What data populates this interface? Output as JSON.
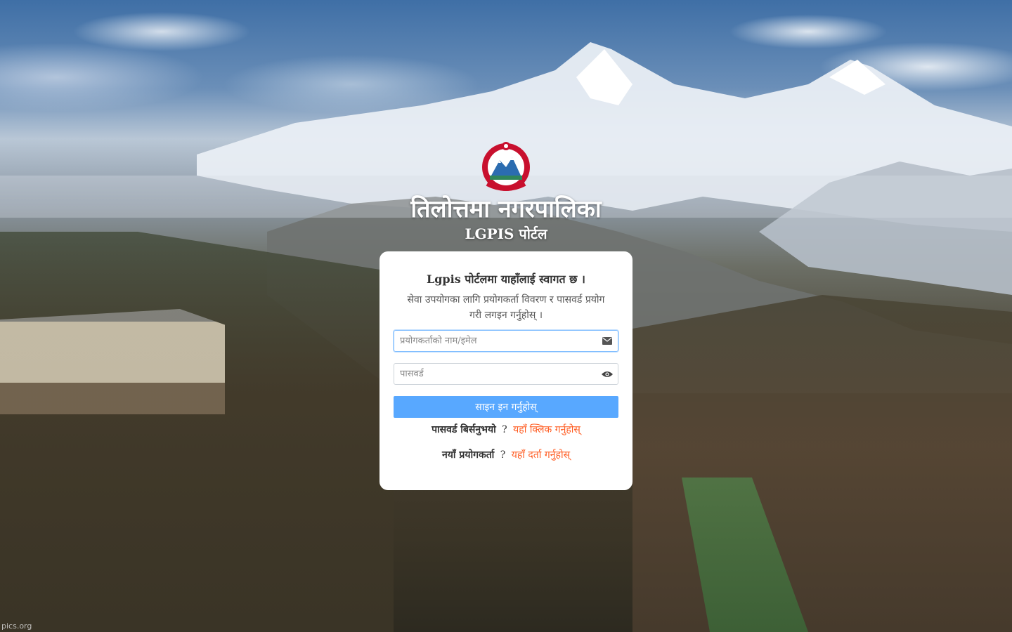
{
  "header": {
    "org_title": "तिलोत्तमा नगरपालिका",
    "portal_title": "LGPIS पोर्टल",
    "emblem_icon": "nepal-emblem-icon"
  },
  "login": {
    "welcome": "Lgpis पोर्टलमा याहाँलाई स्वागत छ ।",
    "description": "सेवा उपयोगका लागि प्रयोगकर्ता विवरण र पासवर्ड प्रयोग गरी लगइन गर्नुहोस् ।",
    "username_placeholder": "प्रयोगकर्ताको नाम/इमेल",
    "password_placeholder": "पासवर्ड",
    "username_icon": "envelope-icon",
    "password_icon": "eye-icon",
    "signin_label": "साइन इन गर्नुहोस्",
    "forgot_label": "पासवर्ड बिर्सनुभयो",
    "forgot_q": "?",
    "forgot_link": "यहाँ क्लिक गर्नुहोस्",
    "new_user_label": "नयाँ प्रयोगकर्ता",
    "new_user_q": "?",
    "register_link": "यहाँ दर्ता गर्नुहोस्"
  },
  "colors": {
    "signin_bg": "#58a8ff",
    "link": "#ff5a1f",
    "card_bg": "#ffffff"
  },
  "credit": "pics.org"
}
